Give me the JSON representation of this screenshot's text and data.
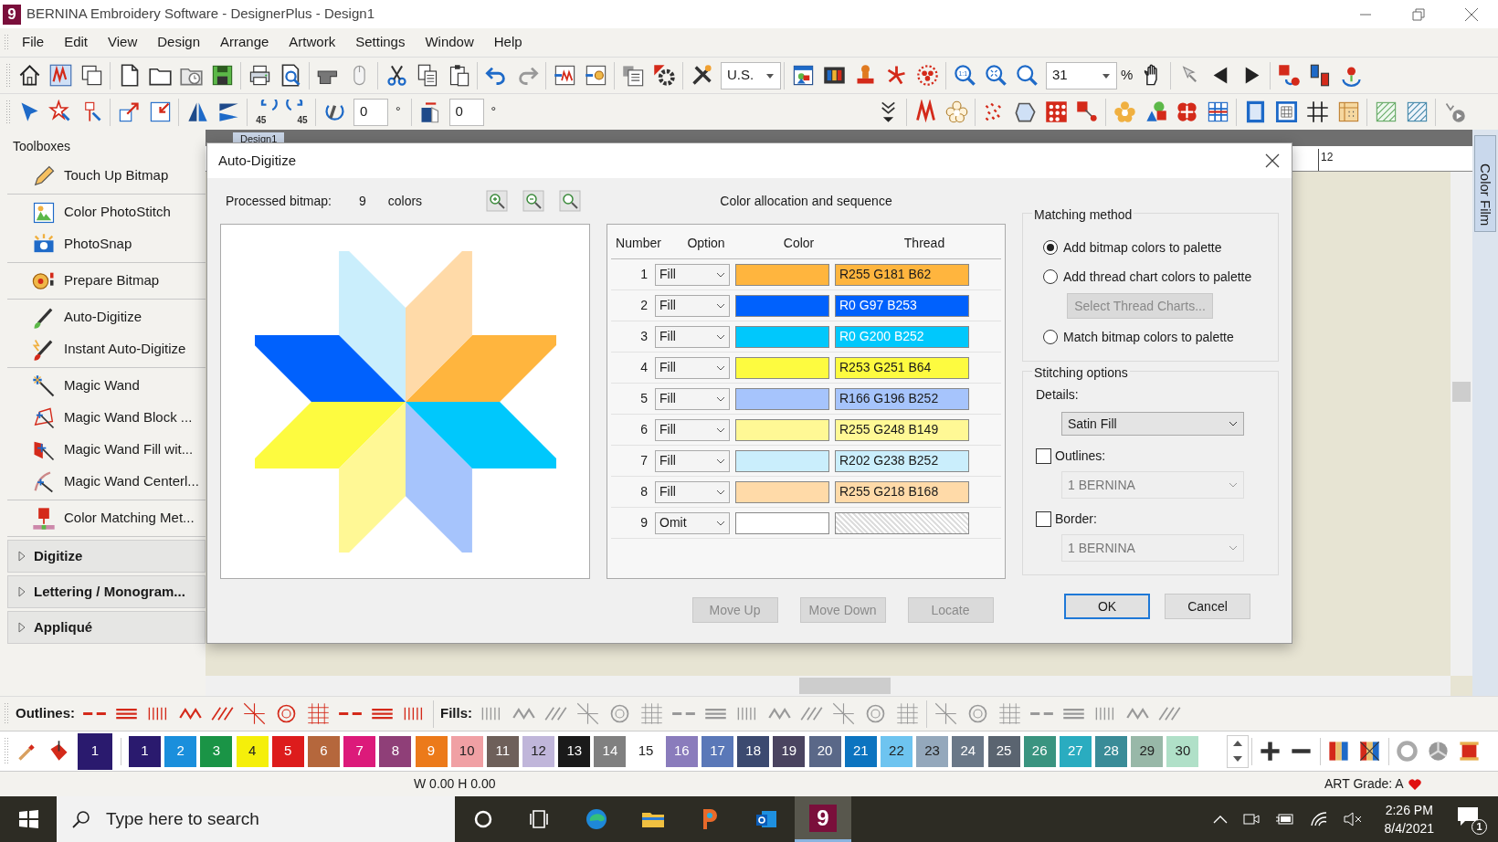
{
  "window": {
    "title": "BERNINA Embroidery Software - DesignerPlus - Design1",
    "app_badge": "9"
  },
  "menu": [
    "File",
    "Edit",
    "View",
    "Design",
    "Arrange",
    "Artwork",
    "Settings",
    "Window",
    "Help"
  ],
  "toolbar": {
    "units": "U.S.",
    "zoom_actual": "1:1",
    "zoom": "31",
    "zoom_unit": "%"
  },
  "toolbar_2": {
    "rotate_steps": [
      "45",
      "45"
    ],
    "rotate": "0",
    "rotate_unit": "°",
    "skew": "0",
    "skew_unit": "°"
  },
  "toolbox": {
    "title": "Toolboxes",
    "groups": [
      {
        "items": [
          {
            "label": "Touch Up Bitmap"
          }
        ]
      },
      {
        "items": [
          {
            "label": "Color PhotoStitch"
          },
          {
            "label": "PhotoSnap"
          }
        ]
      },
      {
        "items": [
          {
            "label": "Prepare Bitmap"
          }
        ]
      },
      {
        "items": [
          {
            "label": "Auto-Digitize"
          },
          {
            "label": "Instant Auto-Digitize"
          }
        ]
      },
      {
        "items": [
          {
            "label": "Magic Wand"
          },
          {
            "label": "Magic Wand Block ..."
          },
          {
            "label": "Magic Wand Fill wit..."
          },
          {
            "label": "Magic Wand Centerl..."
          }
        ]
      },
      {
        "items": [
          {
            "label": "Color Matching Met..."
          }
        ]
      }
    ],
    "sections": [
      {
        "label": "Digitize",
        "expanded": false
      },
      {
        "label": "Lettering / Monogram...",
        "expanded": false
      },
      {
        "label": "Appliqué",
        "expanded": false
      }
    ]
  },
  "document_tab": {
    "label": "Design1"
  },
  "ruler": {
    "label": "12"
  },
  "side_tab": {
    "label": "Color Film"
  },
  "dialog": {
    "title": "Auto-Digitize",
    "processed_label": "Processed bitmap:",
    "color_count": "9",
    "colors_label": "colors",
    "sequence_title": "Color allocation and sequence",
    "table": {
      "columns": [
        "Number",
        "Option",
        "Color",
        "Thread"
      ],
      "rows": [
        {
          "number": "1",
          "option": "Fill",
          "color": "#ffb53e",
          "thread": "R255 G181 B62"
        },
        {
          "number": "2",
          "option": "Fill",
          "color": "#0061fd",
          "thread": "R0 G97 B253"
        },
        {
          "number": "3",
          "option": "Fill",
          "color": "#00c8fc",
          "thread": "R0 G200 B252"
        },
        {
          "number": "4",
          "option": "Fill",
          "color": "#fdfb40",
          "thread": "R253 G251 B64"
        },
        {
          "number": "5",
          "option": "Fill",
          "color": "#a6c4fc",
          "thread": "R166 G196 B252"
        },
        {
          "number": "6",
          "option": "Fill",
          "color": "#fff895",
          "thread": "R255 G248 B149"
        },
        {
          "number": "7",
          "option": "Fill",
          "color": "#caeefc",
          "thread": "R202 G238 B252"
        },
        {
          "number": "8",
          "option": "Fill",
          "color": "#ffdaa8",
          "thread": "R255 G218 B168"
        },
        {
          "number": "9",
          "option": "Omit",
          "color": "#ffffff"
        }
      ]
    },
    "buttons": [
      {
        "label": "Move Up",
        "disabled": true
      },
      {
        "label": "Move Down",
        "disabled": true
      },
      {
        "label": "Locate",
        "disabled": true
      }
    ],
    "matching": {
      "title": "Matching method",
      "items": [
        {
          "kind": "radio",
          "label": "Add bitmap colors to palette",
          "selected": true
        },
        {
          "kind": "radio",
          "label": "Add thread chart colors to palette",
          "selected": false
        },
        {
          "kind": "button",
          "label": "Select Thread Charts...",
          "disabled": true
        },
        {
          "kind": "radio",
          "label": "Match bitmap colors to palette",
          "selected": false
        }
      ]
    },
    "stitching": {
      "title": "Stitching options",
      "details_label": "Details:",
      "details_value": "Satin Fill",
      "options": [
        {
          "label": "Outlines:",
          "checked": false,
          "value": "1 BERNINA",
          "disabled": true
        },
        {
          "label": "Border:",
          "checked": false,
          "value": "1 BERNINA",
          "disabled": true
        }
      ]
    },
    "ok": "OK",
    "cancel": "Cancel"
  },
  "stitch_bar": {
    "outlines_label": "Outlines:",
    "fills_label": "Fills:"
  },
  "palette": {
    "current": {
      "label": "1",
      "color": "#2a1a6e"
    },
    "swatches": [
      {
        "label": "1",
        "color": "#2a1a6e"
      },
      {
        "label": "2",
        "color": "#1a8fdc"
      },
      {
        "label": "3",
        "color": "#1a9446"
      },
      {
        "label": "4",
        "color": "#f5ef0a"
      },
      {
        "label": "5",
        "color": "#dd1c1c"
      },
      {
        "label": "6",
        "color": "#b5673c"
      },
      {
        "label": "7",
        "color": "#dc1a7a"
      },
      {
        "label": "8",
        "color": "#8f3f78"
      },
      {
        "label": "9",
        "color": "#ec7a1a"
      },
      {
        "label": "10",
        "color": "#f0a0a4"
      },
      {
        "label": "11",
        "color": "#6e605a"
      },
      {
        "label": "12",
        "color": "#c0b6da"
      },
      {
        "label": "13",
        "color": "#1a1a1a"
      },
      {
        "label": "14",
        "color": "#808080"
      },
      {
        "label": "15",
        "color": "#ffffff"
      },
      {
        "label": "16",
        "color": "#8a7cbc"
      },
      {
        "label": "17",
        "color": "#5a78b8"
      },
      {
        "label": "18",
        "color": "#3c4a70"
      },
      {
        "label": "19",
        "color": "#4a4460"
      },
      {
        "label": "20",
        "color": "#5a6888"
      },
      {
        "label": "21",
        "color": "#0c74c0"
      },
      {
        "label": "22",
        "color": "#6ec4f0"
      },
      {
        "label": "23",
        "color": "#94a8bc"
      },
      {
        "label": "24",
        "color": "#6a7888"
      },
      {
        "label": "25",
        "color": "#5a6470"
      },
      {
        "label": "26",
        "color": "#3a9480"
      },
      {
        "label": "27",
        "color": "#2aacc0"
      },
      {
        "label": "28",
        "color": "#3a8c98"
      },
      {
        "label": "29",
        "color": "#98b8a8"
      },
      {
        "label": "30",
        "color": "#b0e0c8"
      }
    ]
  },
  "status_bar": {
    "size": "W 0.00 H 0.00",
    "art_grade": "ART Grade: A"
  },
  "taskbar": {
    "app_badge": "9",
    "search": {
      "placeholder": "Type here to search"
    },
    "time": "2:26 PM",
    "date": "8/4/2021",
    "notifications": "1"
  }
}
